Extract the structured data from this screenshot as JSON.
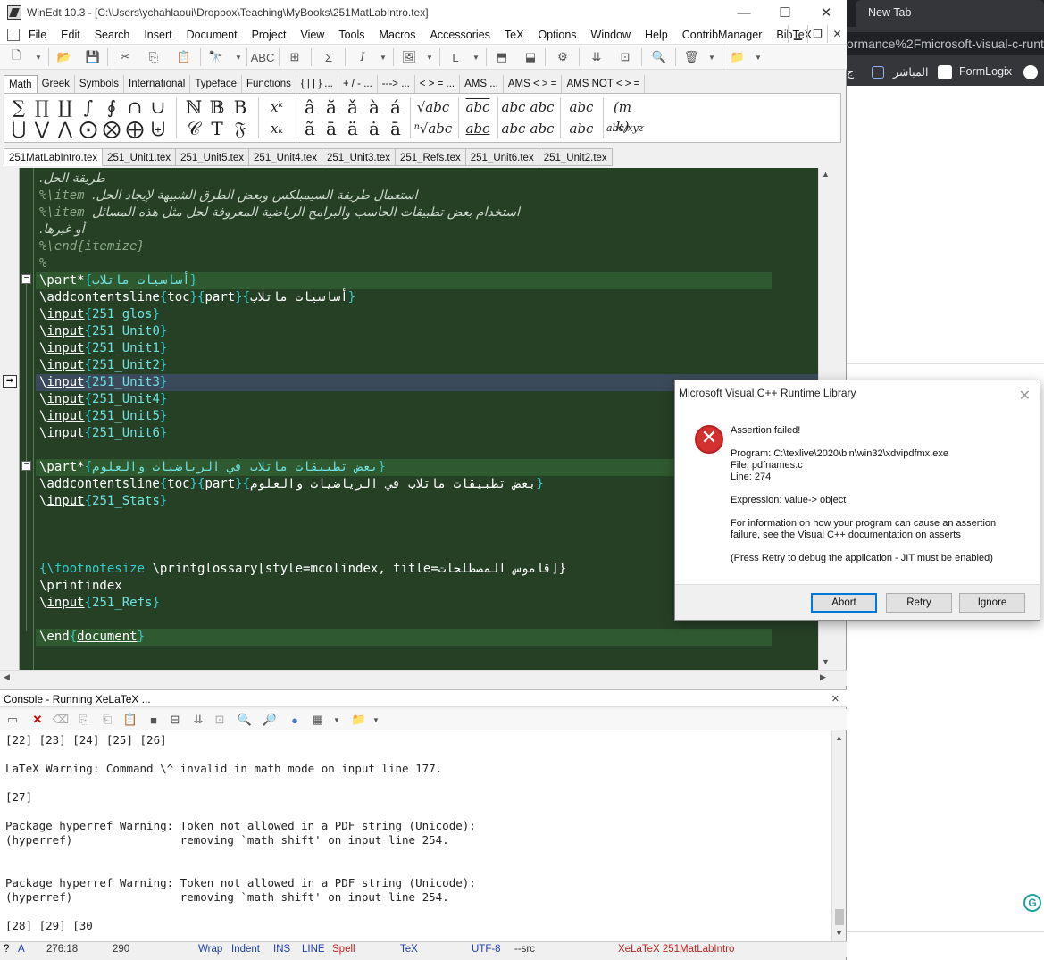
{
  "window": {
    "title": "WinEdt 10.3 - [C:\\Users\\ychahlaoui\\Dropbox\\Teaching\\MyBooks\\251MatLabIntro.tex]"
  },
  "menu": [
    "File",
    "Edit",
    "Search",
    "Insert",
    "Document",
    "Project",
    "View",
    "Tools",
    "Macros",
    "Accessories",
    "TeX",
    "Options",
    "Window",
    "Help",
    "ContribManager",
    "BibTeX"
  ],
  "gui_tabs": [
    "Math",
    "Greek",
    "Symbols",
    "International",
    "Typeface",
    "Functions",
    "{ | | } ...",
    "+ / - ...",
    "---> ...",
    "< > = ...",
    "AMS ...",
    "AMS < > =",
    "AMS NOT < > ="
  ],
  "math_symbols": {
    "row1": [
      "∑",
      "∏",
      "∐",
      "∫",
      "∮",
      "∩",
      "∪",
      "ℕ",
      "𝔹",
      "B",
      "xᵏ",
      "â",
      "ă",
      "ǎ",
      "à",
      "á",
      "√abc",
      "abc",
      "abc",
      "abc",
      "abc",
      "(m k)"
    ],
    "row2": [
      "⋃",
      "⋁",
      "⋀",
      "⨀",
      "⨂",
      "⨁",
      "⨄",
      "𝒞",
      "T",
      "𝔉",
      "xₖ",
      "ã",
      "ā",
      "ä",
      "ȧ",
      "ā",
      "ⁿ√abc",
      "abc",
      "abc",
      "abc",
      "abc",
      "abc/xyz"
    ]
  },
  "doc_tabs": [
    "251MatLabIntro.tex",
    "251_Unit1.tex",
    "251_Unit5.tex",
    "251_Unit4.tex",
    "251_Unit3.tex",
    "251_Refs.tex",
    "251_Unit6.tex",
    "251_Unit2.tex"
  ],
  "editor": {
    "lines": [
      {
        "t": "comment-ar",
        "text": "طريقة الحل."
      },
      {
        "t": "comment",
        "pre": "%\\item ",
        "ar": "استعمال طريقة السيمبلكس وبعض الطرق الشبيهة لإيجاد الحل."
      },
      {
        "t": "comment",
        "pre": "%\\item ",
        "ar": "استخدام بعض تطبيقات الحاسب والبرامج الرياضية المعروفة لحل مثل هذه المسائل"
      },
      {
        "t": "comment-ar",
        "text": "أو غيرها."
      },
      {
        "t": "plain-comment",
        "text": "%\\end{itemize}"
      },
      {
        "t": "plain-comment",
        "text": "%"
      },
      {
        "t": "part",
        "cmd": "\\part*",
        "arg": "أساسيات ماتلاب"
      },
      {
        "t": "acl",
        "cmd": "\\addcontentsline",
        "a1": "toc",
        "a2": "part",
        "a3": "أساسيات ماتلاب"
      },
      {
        "t": "input",
        "cmd": "\\input",
        "arg": "251_glos"
      },
      {
        "t": "input",
        "cmd": "\\input",
        "arg": "251_Unit0"
      },
      {
        "t": "input",
        "cmd": "\\input",
        "arg": "251_Unit1"
      },
      {
        "t": "input",
        "cmd": "\\input",
        "arg": "251_Unit2"
      },
      {
        "t": "input",
        "cmd": "\\input",
        "arg": "251_Unit3"
      },
      {
        "t": "input",
        "cmd": "\\input",
        "arg": "251_Unit4"
      },
      {
        "t": "input",
        "cmd": "\\input",
        "arg": "251_Unit5"
      },
      {
        "t": "input",
        "cmd": "\\input",
        "arg": "251_Unit6"
      },
      {
        "t": "blank"
      },
      {
        "t": "part",
        "cmd": "\\part*",
        "arg": "بعض تطبيقات ماتلاب في الرياضيات والعلوم"
      },
      {
        "t": "acl",
        "cmd": "\\addcontentsline",
        "a1": "toc",
        "a2": "part",
        "a3": "بعض تطبيقات ماتلاب في الرياضيات والعلوم"
      },
      {
        "t": "input",
        "cmd": "\\input",
        "arg": "251_Stats"
      },
      {
        "t": "blank"
      },
      {
        "t": "blank"
      },
      {
        "t": "blank"
      },
      {
        "t": "glossary",
        "text1": "{\\footnotesize ",
        "text2": "\\printglossary",
        "text3": "[style=mcolindex, title=قاموس المصطلحات]}"
      },
      {
        "t": "plain",
        "text": "\\printindex"
      },
      {
        "t": "input",
        "cmd": "\\input",
        "arg": "251_Refs"
      },
      {
        "t": "blank"
      },
      {
        "t": "end",
        "cmd": "\\end",
        "arg": "document"
      }
    ]
  },
  "console": {
    "header": "Console - Running XeLaTeX ...",
    "lines": [
      "[22] [23] [24] [25] [26]",
      "",
      "LaTeX Warning: Command \\^ invalid in math mode on input line 177.",
      "",
      "[27]",
      "",
      "Package hyperref Warning: Token not allowed in a PDF string (Unicode):",
      "(hyperref)                removing `math shift' on input line 254.",
      "",
      "",
      "Package hyperref Warning: Token not allowed in a PDF string (Unicode):",
      "(hyperref)                removing `math shift' on input line 254.",
      "",
      "",
      "[28] [29] [30"
    ]
  },
  "statusbar": {
    "help": "?",
    "mode": "A",
    "position": "276:18",
    "lines": "290",
    "wrap": "Wrap",
    "indent": "Indent",
    "ins": "INS",
    "line": "LINE",
    "spell": "Spell",
    "tex": "TeX",
    "encoding": "UTF-8",
    "src": "--src",
    "compiler": "XeLaTeX 251MatLabIntro"
  },
  "browser": {
    "tab": "New Tab",
    "url": "ormance%2Fmicrosoft-visual-c-runt",
    "bookmark1": "المباشر",
    "bookmark2": "FormLogix"
  },
  "dialog": {
    "title": "Microsoft Visual C++ Runtime Library",
    "heading": "Assertion failed!",
    "program": "Program: C:\\texlive\\2020\\bin\\win32\\xdvipdfmx.exe",
    "file": "File: pdfnames.c",
    "line": "Line: 274",
    "expression": "Expression: value-> object",
    "info1": "For information on how your program can cause an assertion",
    "info2": "failure, see the Visual C++ documentation on asserts",
    "press": "(Press Retry to debug the application - JIT must be enabled)",
    "abort": "Abort",
    "retry": "Retry",
    "ignore": "Ignore"
  },
  "colors": {
    "editor_bg": "#264026",
    "command": "#ffffff",
    "brace": "#33cccc",
    "comment": "#8aa88a"
  }
}
